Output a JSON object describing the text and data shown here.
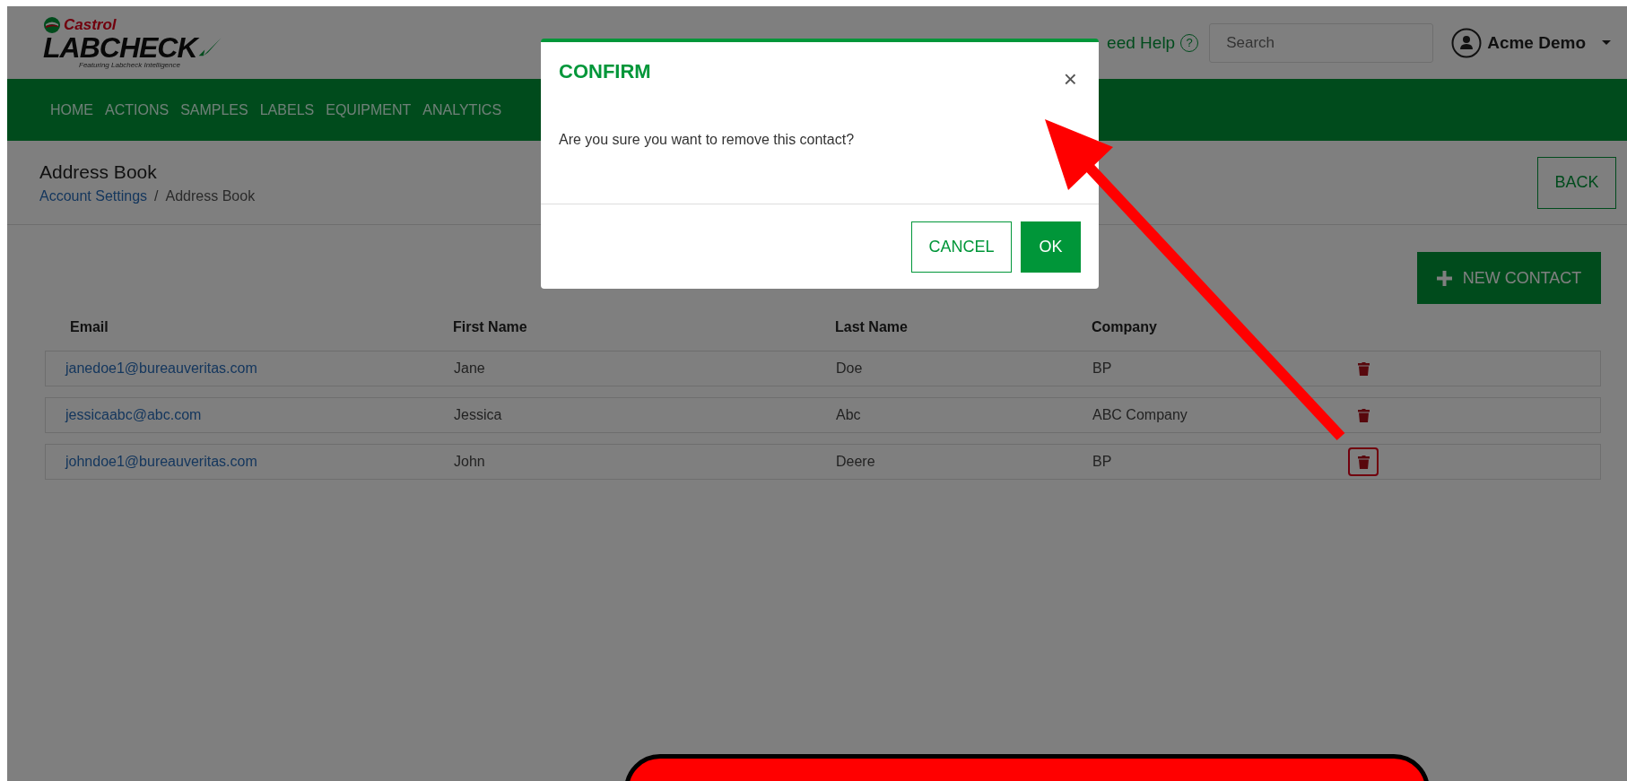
{
  "logo": {
    "brand": "Castrol",
    "product": "LABCHECK",
    "tagline": "Featuring Labcheck Intelligence"
  },
  "header": {
    "help": "eed Help",
    "help_icon": "?",
    "search": {
      "placeholder": "Search"
    },
    "user": "Acme Demo"
  },
  "nav": [
    "HOME",
    "ACTIONS",
    "SAMPLES",
    "LABELS",
    "EQUIPMENT",
    "ANALYTICS"
  ],
  "page": {
    "title": "Address Book",
    "breadcrumb": [
      {
        "label": "Account Settings",
        "kind": "link"
      },
      {
        "label": "/",
        "kind": "separator"
      },
      {
        "label": "Address Book",
        "kind": "current"
      }
    ],
    "back": "BACK",
    "new_contact": "NEW CONTACT"
  },
  "table": {
    "columns": [
      "Email",
      "First Name",
      "Last Name",
      "Company"
    ],
    "rows": [
      {
        "email": "janedoe1@bureauveritas.com",
        "first_name": "Jane",
        "last_name": "Doe",
        "company": "BP",
        "highlighted": false
      },
      {
        "email": "jessicaabc@abc.com",
        "first_name": "Jessica",
        "last_name": "Abc",
        "company": "ABC Company",
        "highlighted": false
      },
      {
        "email": "johndoe1@bureauveritas.com",
        "first_name": "John",
        "last_name": "Deere",
        "company": "BP",
        "highlighted": true
      }
    ]
  },
  "dialog": {
    "title": "CONFIRM",
    "close": "×",
    "message": "Are you sure you want to remove this contact?",
    "buttons": [
      {
        "label": "CANCEL",
        "kind": "secondary"
      },
      {
        "label": "OK",
        "kind": "primary"
      }
    ]
  },
  "annotations": {
    "arrow": true,
    "callout": true
  }
}
